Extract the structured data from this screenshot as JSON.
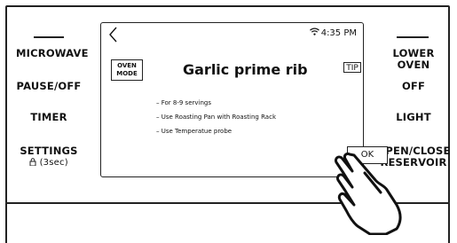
{
  "left_controls": {
    "microwave": "MICROWAVE",
    "pause_off": "PAUSE/OFF",
    "timer": "TIMER",
    "settings": "SETTINGS",
    "settings_sub": "(3sec)"
  },
  "right_controls": {
    "lower_oven": "LOWER OVEN",
    "off": "OFF",
    "light": "LIGHT",
    "open_close_line1": "OPEN/CLOSE",
    "open_close_line2": "RESERVOIR"
  },
  "screen": {
    "time": "4:35 PM",
    "mode_line1": "OVEN",
    "mode_line2": "MODE",
    "title": "Garlic prime rib",
    "tip_label": "TIP",
    "notes": [
      "For 8-9 servings",
      "Use Roasting Pan with Roasting Rack",
      "Use Temperatue probe"
    ],
    "ok_label": "OK"
  },
  "icons": {
    "back": "chevron-left-icon",
    "wifi": "wifi-icon",
    "lock": "lock-icon",
    "hand": "pointing-hand-icon"
  }
}
